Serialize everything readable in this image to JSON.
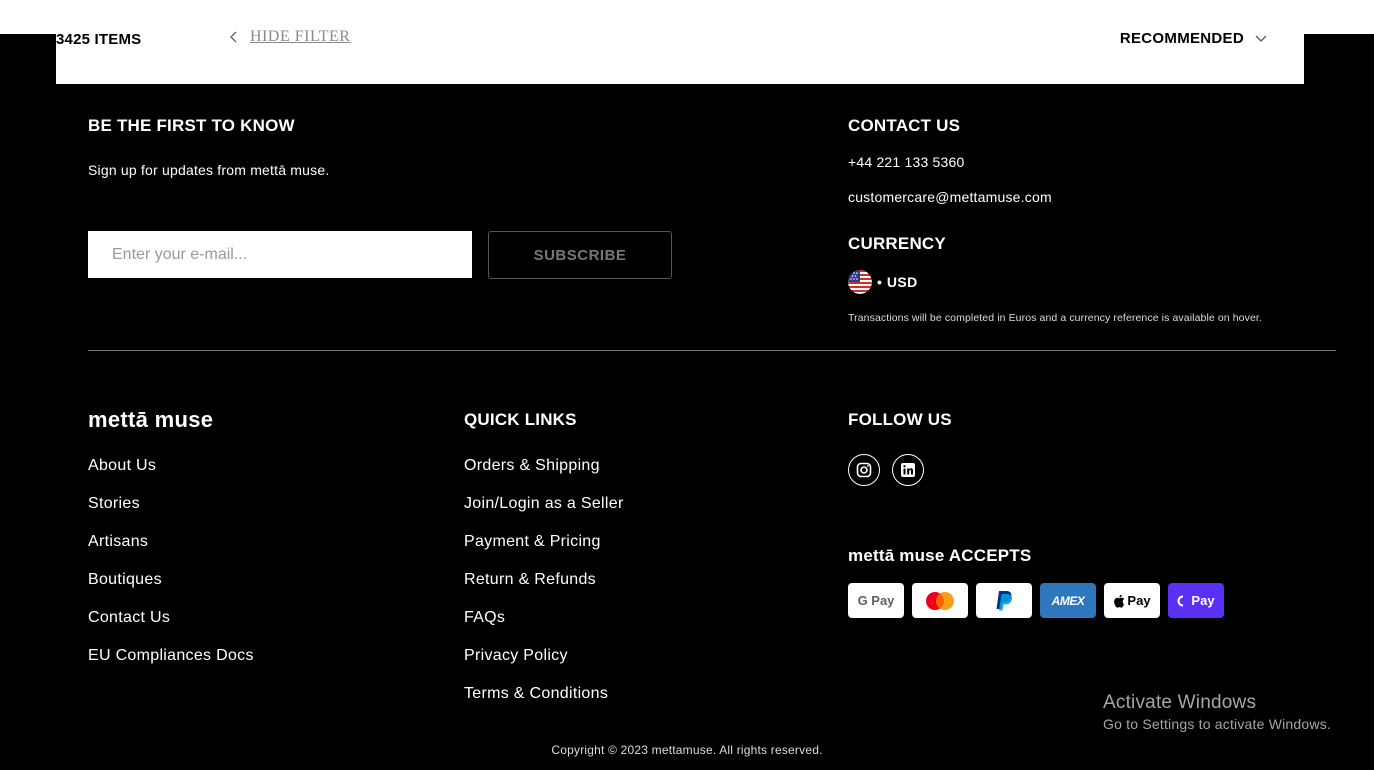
{
  "filter_bar": {
    "items_count": "3425 ITEMS",
    "hide_filter": "HIDE FILTER",
    "sort_label": "RECOMMENDED"
  },
  "newsletter": {
    "heading": "BE THE FIRST TO KNOW",
    "subtext": "Sign up for updates from mettā muse.",
    "email_placeholder": "Enter your e-mail...",
    "subscribe_label": "SUBSCRIBE"
  },
  "contact": {
    "heading": "CONTACT US",
    "phone": "+44 221 133 5360",
    "email": "customercare@mettamuse.com"
  },
  "currency": {
    "heading": "CURRENCY",
    "bullet": "•",
    "code": "USD",
    "note": "Transactions will be completed in Euros and a currency reference is available on hover."
  },
  "brand": {
    "name": "mettā muse",
    "links": [
      "About Us",
      "Stories",
      "Artisans",
      "Boutiques",
      "Contact Us",
      "EU Compliances Docs"
    ]
  },
  "quick_links": {
    "heading": "QUICK LINKS",
    "links": [
      "Orders & Shipping",
      "Join/Login as a Seller",
      "Payment & Pricing",
      "Return & Refunds",
      "FAQs",
      "Privacy Policy",
      "Terms & Conditions"
    ]
  },
  "follow": {
    "heading": "FOLLOW US",
    "icons": [
      "instagram-icon",
      "linkedin-icon"
    ]
  },
  "accepts": {
    "heading": "mettā muse ACCEPTS",
    "methods": {
      "gpay": "G Pay",
      "amex": "AMEX",
      "apple": "Pay",
      "shop": "Pay"
    }
  },
  "watermark": {
    "title": "Activate Windows",
    "subtitle": "Go to Settings to activate Windows."
  },
  "copyright": "Copyright © 2023 mettamuse. All rights reserved.",
  "colors": {
    "background": "#000000",
    "amex": "#2e77bc",
    "shop_pay": "#5a31f4"
  }
}
